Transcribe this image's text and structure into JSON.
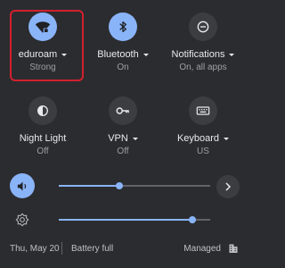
{
  "tiles": [
    {
      "label": "eduroam",
      "sub": "Strong",
      "icon": "wifi-locked-icon",
      "active": true,
      "has_menu": true
    },
    {
      "label": "Bluetooth",
      "sub": "On",
      "icon": "bluetooth-icon",
      "active": true,
      "has_menu": true
    },
    {
      "label": "Notifications",
      "sub": "On, all apps",
      "icon": "do-not-disturb-icon",
      "active": false,
      "has_menu": true
    },
    {
      "label": "Night Light",
      "sub": "Off",
      "icon": "night-light-icon",
      "active": false,
      "has_menu": false
    },
    {
      "label": "VPN",
      "sub": "Off",
      "icon": "vpn-key-icon",
      "active": false,
      "has_menu": true
    },
    {
      "label": "Keyboard",
      "sub": "US",
      "icon": "keyboard-icon",
      "active": false,
      "has_menu": true
    }
  ],
  "sliders": {
    "volume": {
      "icon": "volume-icon",
      "level": 0.4,
      "active": true
    },
    "brightness": {
      "icon": "brightness-icon",
      "level": 0.88,
      "active": false
    }
  },
  "audio_settings_icon": "chevron-right-icon",
  "status": {
    "date": "Thu, May 20",
    "battery": "Battery full",
    "managed": "Managed",
    "managed_icon": "enterprise-building-icon"
  },
  "colors": {
    "background": "#2b2c2f",
    "accent": "#8ab4f8",
    "highlight_box": "#d3202f"
  }
}
